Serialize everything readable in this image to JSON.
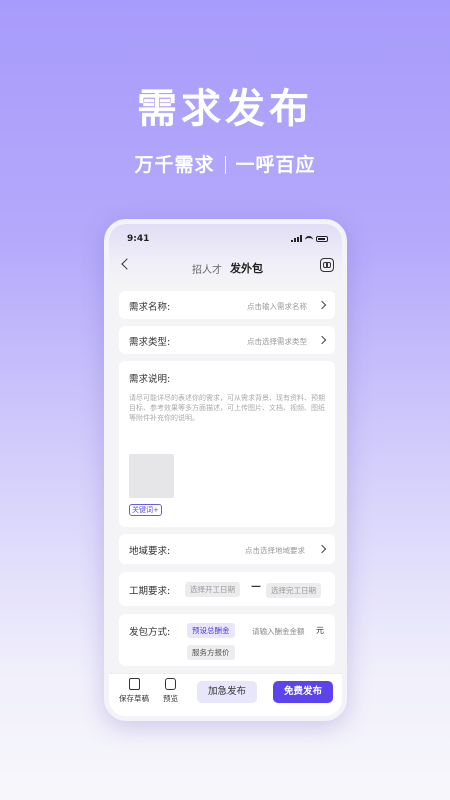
{
  "hero": {
    "title": "需求发布",
    "sub_left": "万千需求",
    "sub_right": "一呼百应"
  },
  "status": {
    "time": "9:41"
  },
  "nav": {
    "tab_recruit": "招人才",
    "tab_outsource": "发外包"
  },
  "form": {
    "name": {
      "label": "需求名称:",
      "placeholder": "点击输入需求名称"
    },
    "type": {
      "label": "需求类型:",
      "placeholder": "点击选择需求类型"
    },
    "description": {
      "label": "需求说明:",
      "placeholder": "请尽可能详尽的表述你的需求，可从需求背景、现有资料、预期目标、参考效果等多方面描述，可上传图片、文档、视频、图纸等附件补充你的说明。",
      "keyword": "关键词+"
    },
    "region": {
      "label": "地域要求:",
      "placeholder": "点击选择地域要求"
    },
    "period": {
      "label": "工期要求:",
      "start": "选择开工日期",
      "dash": "—",
      "end": "选择完工日期"
    },
    "payment": {
      "label": "发包方式:",
      "option_preset": "预设总酬金",
      "amount_placeholder": "请输入酬金金额",
      "unit": "元",
      "option_quote": "服务方报价"
    }
  },
  "bottom": {
    "save_draft": "保存草稿",
    "preview": "预览",
    "urgent_publish": "加急发布",
    "free_publish": "免费发布"
  },
  "colors": {
    "primary": "#5d43ec",
    "light": "#e8e6fb",
    "hero_bg": "#a89bfb"
  },
  "icons": [
    "back-icon",
    "help-icon",
    "chevron-right-icon",
    "draft-icon",
    "preview-icon"
  ]
}
